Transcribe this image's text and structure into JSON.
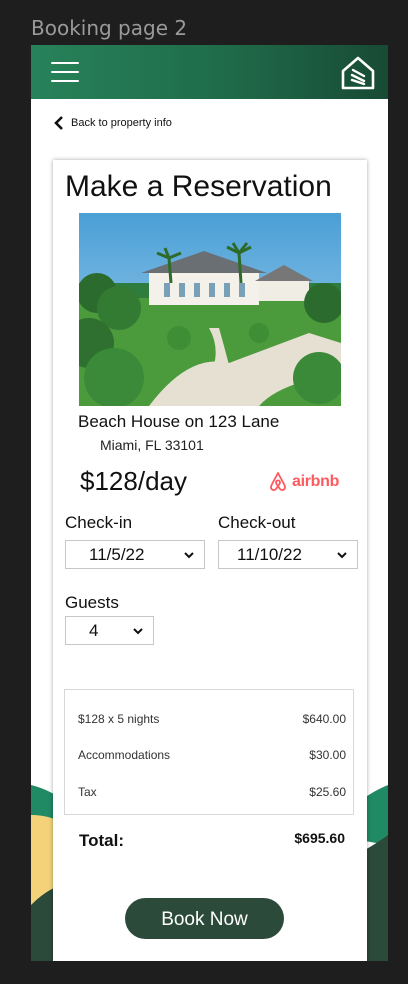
{
  "frame_label": "Booking page 2",
  "nav": {
    "back_label": "Back to property info"
  },
  "reservation": {
    "title": "Make a Reservation",
    "property_name": "Beach House on 123 Lane",
    "location": "Miami, FL 33101",
    "price": "$128/day",
    "platform": "airbnb",
    "checkin_label": "Check-in",
    "checkin_value": "11/5/22",
    "checkout_label": "Check-out",
    "checkout_value": "11/10/22",
    "guests_label": "Guests",
    "guests_value": "4"
  },
  "summary": {
    "rows": [
      {
        "label": "$128 x 5 nights",
        "value": "$640.00"
      },
      {
        "label": "Accommodations",
        "value": "$30.00"
      },
      {
        "label": "Tax",
        "value": "$25.60"
      }
    ],
    "total_label": "Total:",
    "total_value": "$695.60"
  },
  "cta": {
    "book_label": "Book Now"
  },
  "colors": {
    "header_green": "#27825a",
    "button_dark": "#2c4a3a",
    "airbnb": "#ff5a5f",
    "accent_yellow": "#f3d27a"
  },
  "icons": [
    "hamburger-menu-icon",
    "home-logo-icon",
    "chevron-left-icon",
    "airbnb-logo-icon",
    "caret-down-icon"
  ]
}
